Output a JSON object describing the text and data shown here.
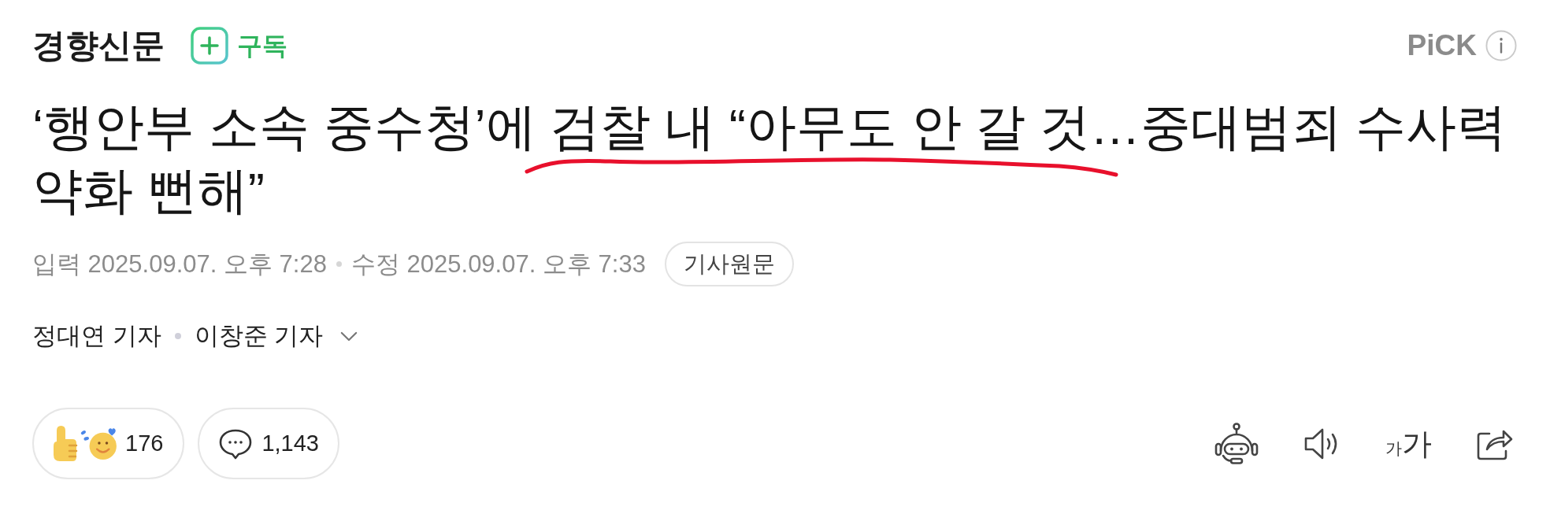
{
  "header": {
    "logo": "경향신문",
    "subscribe_button": "구독",
    "pick_label": "PiCK"
  },
  "headline_lines": [
    "‘행안부 소속 중수청’에 검찰 내 “아무도 안 갈 것…중대범죄 수사력",
    "약화 뻔해”"
  ],
  "meta": {
    "published": "입력 2025.09.07. 오후 7:28",
    "modified": "수정 2025.09.07. 오후 7:33",
    "original_link": "기사원문"
  },
  "bylines": [
    "정대연 기자",
    "이창준 기자"
  ],
  "reactions": {
    "count": "176"
  },
  "comments": {
    "count": "1,143"
  },
  "toolbar": {
    "font_size_small": "가",
    "font_size_large": "가"
  }
}
